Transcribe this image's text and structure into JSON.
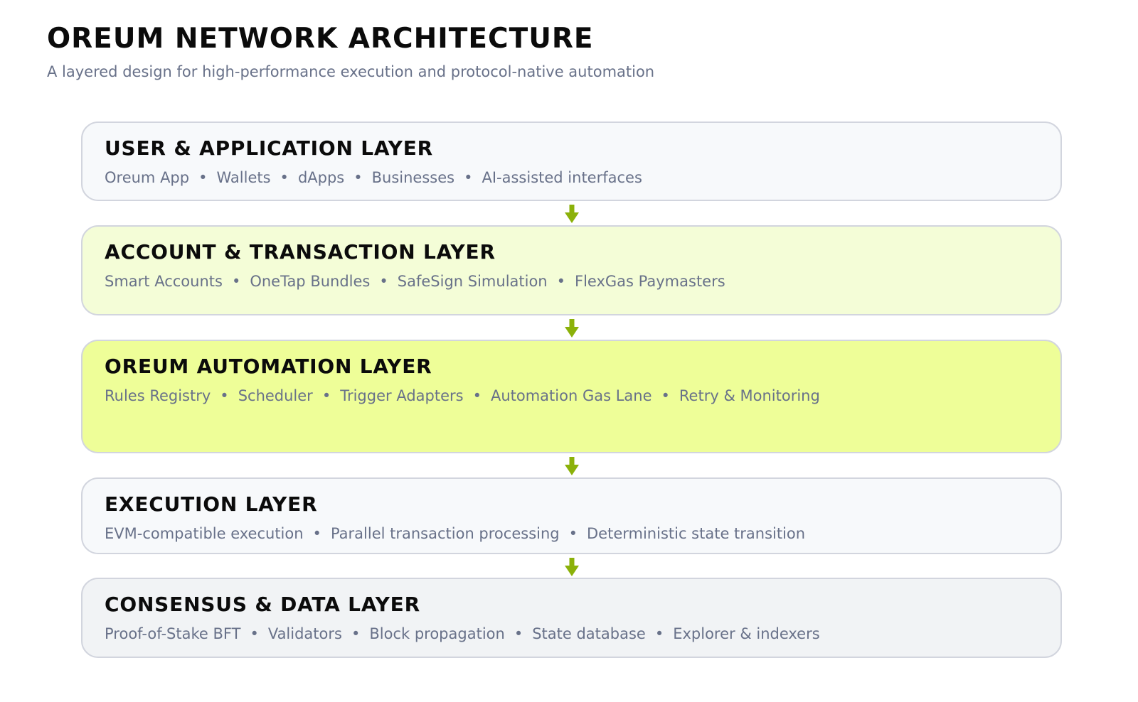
{
  "header": {
    "title": "OREUM NETWORK ARCHITECTURE",
    "subtitle": "A layered design for high-performance execution and protocol-native automation"
  },
  "colors": {
    "accent": "#8bb10a",
    "layer_light": "#f7f9fb",
    "layer_transaction": "#f4fdd7",
    "layer_automation": "#eefe98",
    "layer_consensus": "#f1f3f5",
    "border": "#d2d5de"
  },
  "separator": "•",
  "layers": [
    {
      "title": "USER & APPLICATION LAYER",
      "items": [
        "Oreum App",
        "Wallets",
        "dApps",
        "Businesses",
        "AI-assisted interfaces"
      ]
    },
    {
      "title": "ACCOUNT & TRANSACTION LAYER",
      "items": [
        "Smart Accounts",
        "OneTap Bundles",
        "SafeSign Simulation",
        "FlexGas Paymasters"
      ]
    },
    {
      "title": "OREUM AUTOMATION LAYER",
      "items": [
        "Rules Registry",
        "Scheduler",
        "Trigger Adapters",
        "Automation Gas Lane",
        "Retry & Monitoring"
      ]
    },
    {
      "title": "EXECUTION LAYER",
      "items": [
        "EVM-compatible execution",
        "Parallel transaction processing",
        "Deterministic state transition"
      ]
    },
    {
      "title": "CONSENSUS & DATA LAYER",
      "items": [
        "Proof-of-Stake BFT",
        "Validators",
        "Block propagation",
        "State database",
        "Explorer & indexers"
      ]
    }
  ],
  "connectors": [
    {
      "from": "USER & APPLICATION LAYER",
      "to": "ACCOUNT & TRANSACTION LAYER",
      "icon": "arrow-down-icon"
    },
    {
      "from": "ACCOUNT & TRANSACTION LAYER",
      "to": "OREUM AUTOMATION LAYER",
      "icon": "arrow-down-icon"
    },
    {
      "from": "OREUM AUTOMATION LAYER",
      "to": "EXECUTION LAYER",
      "icon": "arrow-down-icon"
    },
    {
      "from": "EXECUTION LAYER",
      "to": "CONSENSUS & DATA LAYER",
      "icon": "arrow-down-icon"
    }
  ]
}
